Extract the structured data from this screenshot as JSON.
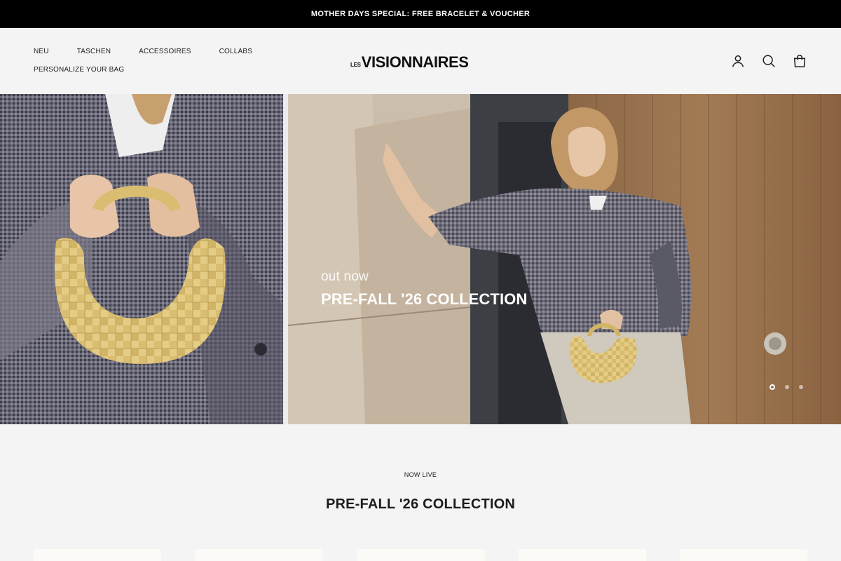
{
  "announcement": {
    "text": "MOTHER DAYS SPECIAL: FREE BRACELET & VOUCHER"
  },
  "nav": {
    "items": [
      {
        "label": "NEU"
      },
      {
        "label": "TASCHEN"
      },
      {
        "label": "ACCESSOIRES"
      },
      {
        "label": "COLLABS"
      },
      {
        "label": "PERSONALIZE YOUR BAG"
      }
    ]
  },
  "logo": {
    "prefix": "LES",
    "name": "VISIONNAIRES"
  },
  "header_icons": [
    "account-icon",
    "search-icon",
    "cart-bag-icon"
  ],
  "hero": {
    "eyebrow": "out now",
    "title": "PRE-FALL '26 COLLECTION",
    "slide_count": 3,
    "active_slide": 1
  },
  "section": {
    "eyebrow": "NOW LIVE",
    "title": "PRE-FALL '26 COLLECTION"
  },
  "colors": {
    "announcement_bg": "#000000",
    "page_bg": "#f4f4f4",
    "text": "#1c1c1c",
    "bag_yellow": "#e4cc85"
  }
}
